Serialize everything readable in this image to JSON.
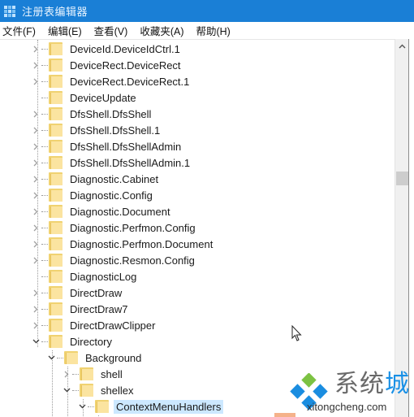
{
  "window": {
    "title": "注册表编辑器",
    "icon": "registry-editor-icon"
  },
  "menu": [
    {
      "label": "文件(F)"
    },
    {
      "label": "编辑(E)"
    },
    {
      "label": "查看(V)"
    },
    {
      "label": "收藏夹(A)"
    },
    {
      "label": "帮助(H)"
    }
  ],
  "tree": {
    "items": [
      {
        "label": "DeviceId.DeviceIdCtrl.1",
        "expander": "collapsed"
      },
      {
        "label": "DeviceRect.DeviceRect",
        "expander": "collapsed"
      },
      {
        "label": "DeviceRect.DeviceRect.1",
        "expander": "collapsed"
      },
      {
        "label": "DeviceUpdate",
        "expander": "none"
      },
      {
        "label": "DfsShell.DfsShell",
        "expander": "collapsed"
      },
      {
        "label": "DfsShell.DfsShell.1",
        "expander": "collapsed"
      },
      {
        "label": "DfsShell.DfsShellAdmin",
        "expander": "collapsed"
      },
      {
        "label": "DfsShell.DfsShellAdmin.1",
        "expander": "collapsed"
      },
      {
        "label": "Diagnostic.Cabinet",
        "expander": "collapsed"
      },
      {
        "label": "Diagnostic.Config",
        "expander": "collapsed"
      },
      {
        "label": "Diagnostic.Document",
        "expander": "collapsed"
      },
      {
        "label": "Diagnostic.Perfmon.Config",
        "expander": "collapsed"
      },
      {
        "label": "Diagnostic.Perfmon.Document",
        "expander": "collapsed"
      },
      {
        "label": "Diagnostic.Resmon.Config",
        "expander": "collapsed"
      },
      {
        "label": "DiagnosticLog",
        "expander": "none"
      },
      {
        "label": "DirectDraw",
        "expander": "collapsed"
      },
      {
        "label": "DirectDraw7",
        "expander": "collapsed"
      },
      {
        "label": "DirectDrawClipper",
        "expander": "collapsed"
      },
      {
        "label": "Directory",
        "expander": "expanded"
      },
      {
        "label": "Background",
        "expander": "expanded"
      },
      {
        "label": "shell",
        "expander": "collapsed"
      },
      {
        "label": "shellex",
        "expander": "expanded"
      },
      {
        "label": "ContextMenuHandlers",
        "expander": "expanded",
        "selected": true
      }
    ]
  },
  "watermark": {
    "text_gray": "系统",
    "text_blue": "城",
    "url": "xitongcheng.com"
  },
  "colors": {
    "titlebar": "#1a7fd6",
    "selection": "#cce8ff",
    "folder": "#f0d271",
    "watermark_blue": "#1990e6"
  }
}
